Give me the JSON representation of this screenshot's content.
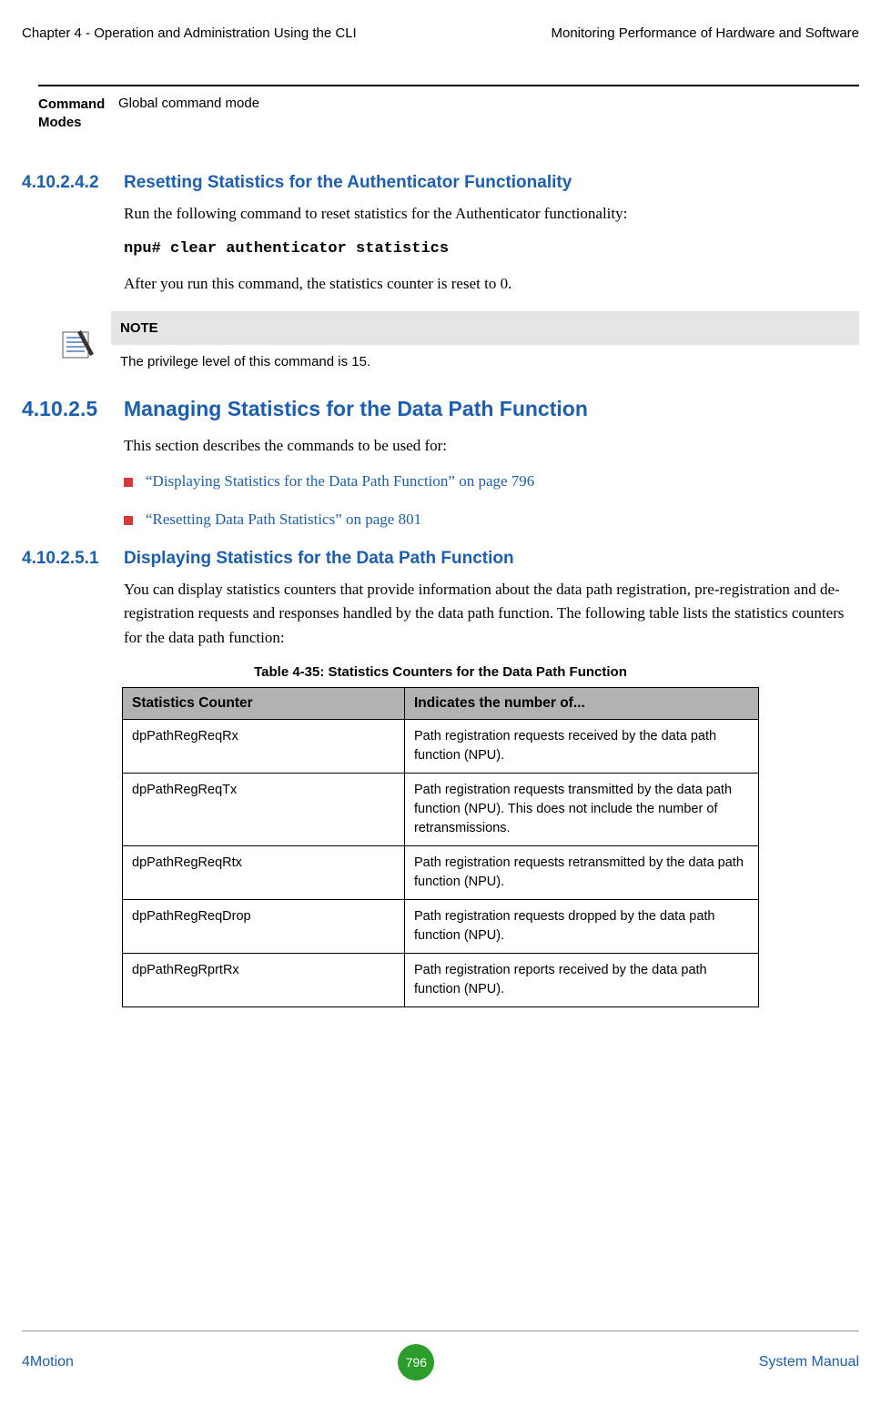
{
  "header": {
    "left": "Chapter 4 - Operation and Administration Using the CLI",
    "right": "Monitoring Performance of Hardware and Software"
  },
  "command_modes": {
    "label_line1": "Command",
    "label_line2": "Modes",
    "value": "Global command mode"
  },
  "sec_4_10_2_4_2": {
    "num": "4.10.2.4.2",
    "title": "Resetting Statistics for the Authenticator Functionality",
    "p1": "Run the following command to reset statistics for the Authenticator functionality:",
    "code": "npu# clear authenticator statistics",
    "p2": "After you run this command, the statistics counter is reset to 0."
  },
  "note": {
    "header": "NOTE",
    "body": "The privilege level of this command is 15."
  },
  "sec_4_10_2_5": {
    "num": "4.10.2.5",
    "title": "Managing Statistics for the Data Path Function",
    "intro": "This section describes the commands to be used for:",
    "bullets": [
      "“Displaying Statistics for the Data Path Function” on page 796",
      "“Resetting Data Path Statistics” on page 801"
    ]
  },
  "sec_4_10_2_5_1": {
    "num": "4.10.2.5.1",
    "title": "Displaying Statistics for the Data Path Function",
    "p1": "You can display statistics counters that provide information about the data path registration, pre-registration and de-registration requests and responses handled by the data path function. The following table lists the statistics counters for the data path function:"
  },
  "table": {
    "caption": "Table 4-35: Statistics Counters for the Data Path Function",
    "headers": [
      "Statistics Counter",
      "Indicates the number of..."
    ],
    "rows": [
      [
        "dpPathRegReqRx",
        "Path registration requests received by the data path function (NPU)."
      ],
      [
        "dpPathRegReqTx",
        "Path registration requests transmitted by the data path function (NPU). This does not include the number of retransmissions."
      ],
      [
        "dpPathRegReqRtx",
        "Path registration requests retransmitted by the data path function (NPU)."
      ],
      [
        "dpPathRegReqDrop",
        "Path registration requests dropped by the data path function (NPU)."
      ],
      [
        "dpPathRegRprtRx",
        "Path registration reports received by the data path function (NPU)."
      ]
    ]
  },
  "footer": {
    "left": "4Motion",
    "page": "796",
    "right": "System Manual"
  }
}
